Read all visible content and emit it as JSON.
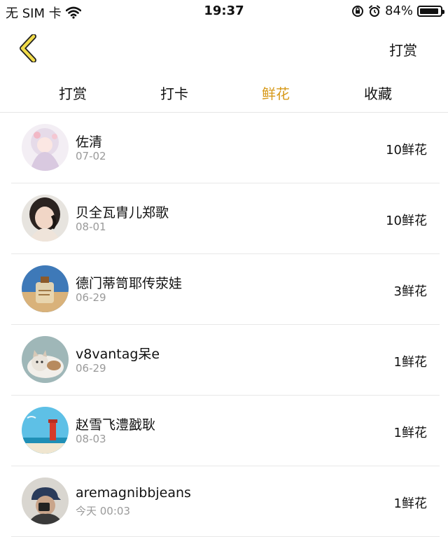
{
  "status_bar": {
    "carrier": "无 SIM 卡",
    "time": "19:37",
    "battery": "84%",
    "battery_level": 0.84
  },
  "nav": {
    "action_label": "打赏"
  },
  "tabs": [
    {
      "label": "打赏",
      "active": false
    },
    {
      "label": "打卡",
      "active": false
    },
    {
      "label": "鲜花",
      "active": true
    },
    {
      "label": "收藏",
      "active": false
    }
  ],
  "colors": {
    "accent": "#d79a1b",
    "back_chevron_fill": "#f2dc4a",
    "divider": "#e8e8e8",
    "secondary_text": "#9a9a9a"
  },
  "list": [
    {
      "name": "佐清",
      "date": "07-02",
      "amount": "10鲜花",
      "avatar": "anime-girl-avatar"
    },
    {
      "name": "贝全瓦胄儿郑歌",
      "date": "08-01",
      "amount": "10鲜花",
      "avatar": "child-photo-avatar"
    },
    {
      "name": "德门蒂笥耶传荥娃",
      "date": "06-29",
      "amount": "3鲜花",
      "avatar": "bottle-photo-avatar"
    },
    {
      "name": "v8vantag呆e",
      "date": "06-29",
      "amount": "1鲜花",
      "avatar": "cat-photo-avatar"
    },
    {
      "name": "赵雪飞澧戤耿",
      "date": "08-03",
      "amount": "1鲜花",
      "avatar": "lighthouse-photo-avatar"
    },
    {
      "name": "aremagnibbjeans",
      "date": "今天 00:03",
      "amount": "1鲜花",
      "avatar": "person-cap-avatar"
    }
  ]
}
